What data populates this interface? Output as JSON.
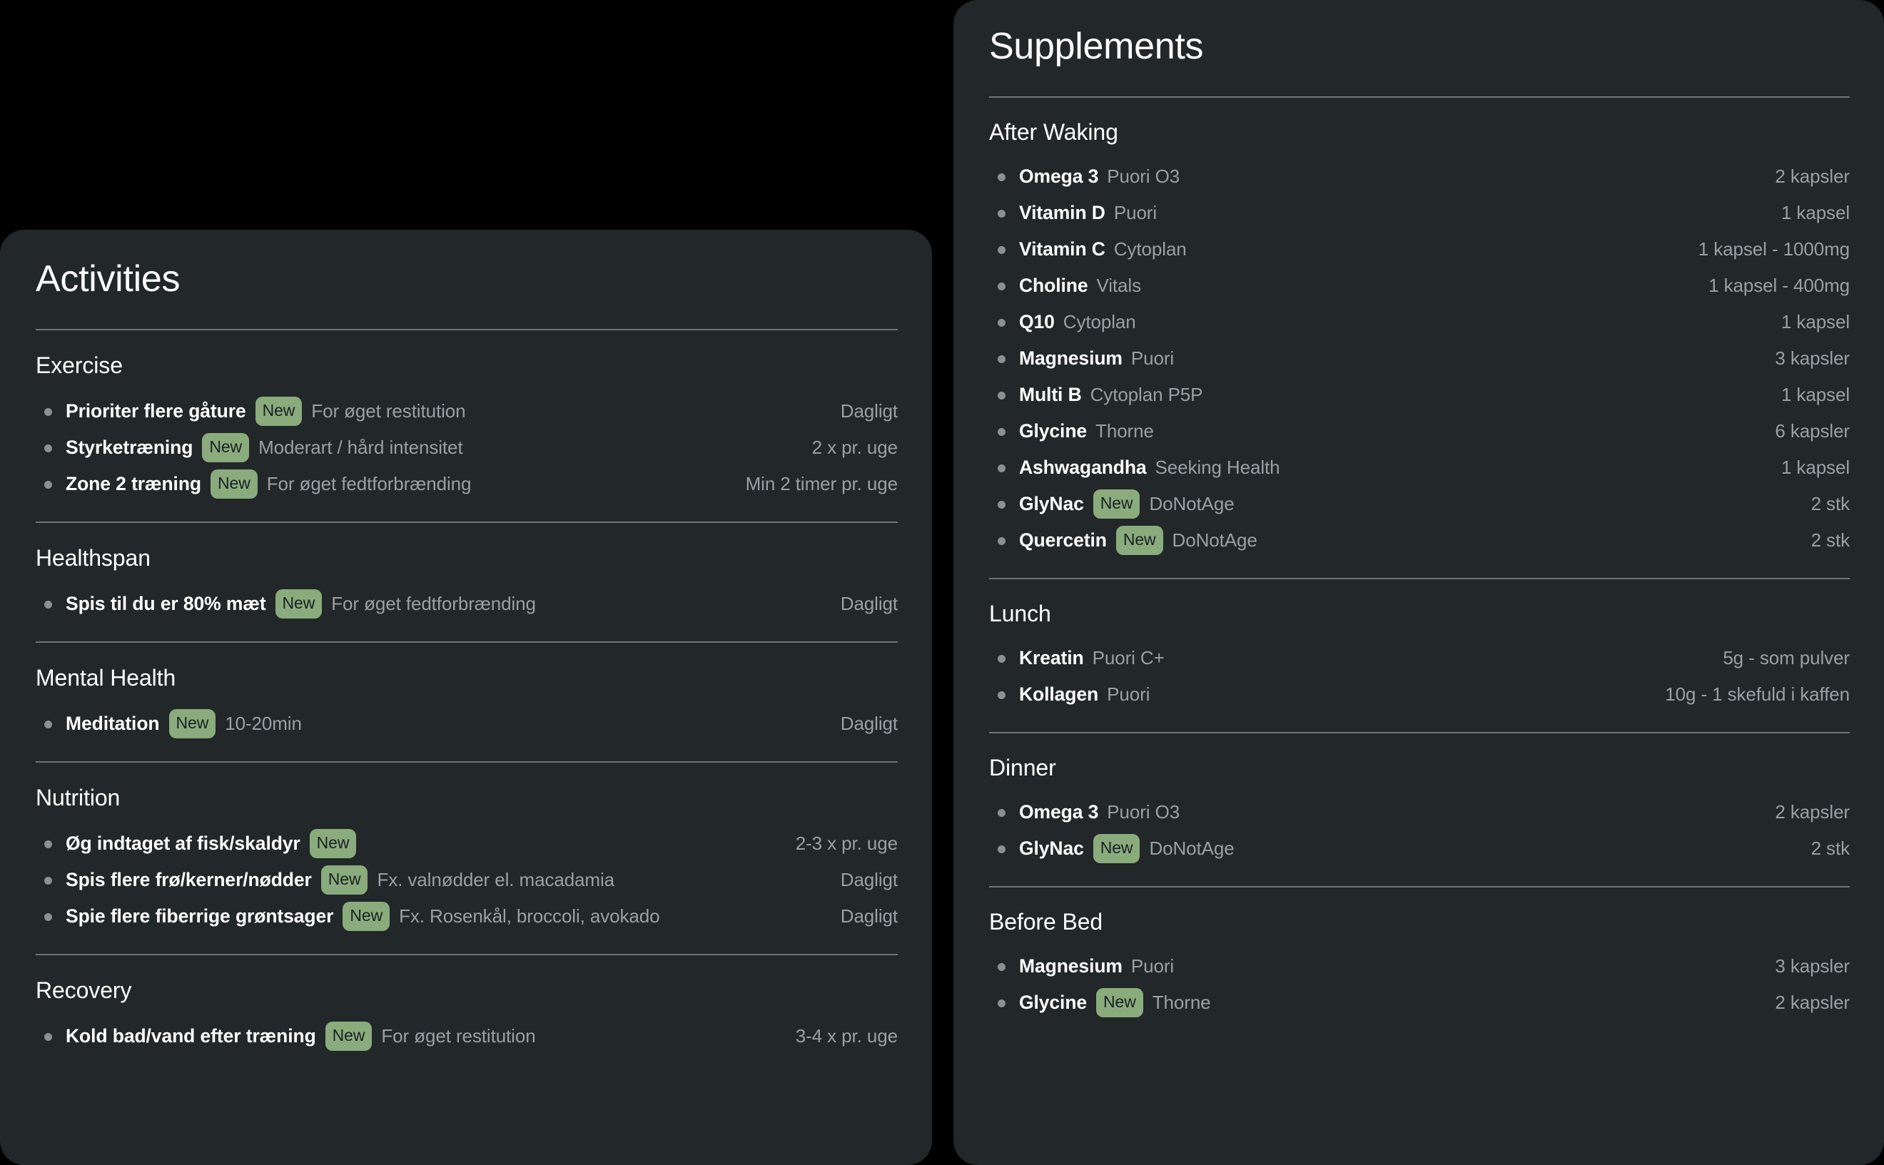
{
  "theme": {
    "page_background": "#000000",
    "panel_background": "#222729",
    "rule_color": "#6d7477",
    "badge_background": "#8aab7c",
    "badge_text": "#1b2124",
    "primary_text": "#ffffff",
    "muted_text": "#9aa0a3",
    "bullet_color": "#8b9093"
  },
  "badge_label": "New",
  "activities": {
    "title": "Activities",
    "sections": [
      {
        "heading": "Exercise",
        "rows": [
          {
            "name": "Prioriter flere gåture",
            "badge": "New",
            "note": "For øget restitution",
            "value": "Dagligt"
          },
          {
            "name": "Styrketræning",
            "badge": "New",
            "note": "Moderart / hård intensitet",
            "value": "2 x pr. uge"
          },
          {
            "name": "Zone 2 træning",
            "badge": "New",
            "note": "For øget fedtforbrænding",
            "value": "Min 2 timer pr. uge"
          }
        ]
      },
      {
        "heading": "Healthspan",
        "rows": [
          {
            "name": "Spis til du er 80% mæt",
            "badge": "New",
            "note": "For øget fedtforbrænding",
            "value": "Dagligt"
          }
        ]
      },
      {
        "heading": "Mental Health",
        "rows": [
          {
            "name": "Meditation",
            "badge": "New",
            "note": "10-20min",
            "value": "Dagligt"
          }
        ]
      },
      {
        "heading": "Nutrition",
        "rows": [
          {
            "name": "Øg indtaget af fisk/skaldyr",
            "badge": "New",
            "note": "",
            "value": "2-3 x pr. uge"
          },
          {
            "name": "Spis flere frø/kerner/nødder",
            "badge": "New",
            "note": "Fx. valnødder el. macadamia",
            "value": "Dagligt"
          },
          {
            "name": "Spie flere fiberrige grøntsager",
            "badge": "New",
            "note": "Fx. Rosenkål, broccoli, avokado",
            "value": "Dagligt"
          }
        ]
      },
      {
        "heading": "Recovery",
        "rows": [
          {
            "name": "Kold bad/vand efter træning",
            "badge": "New",
            "note": "For øget restitution",
            "value": "3-4 x pr. uge"
          }
        ]
      }
    ]
  },
  "supplements": {
    "title": "Supplements",
    "sections": [
      {
        "heading": "After Waking",
        "rows": [
          {
            "name": "Omega 3",
            "badge": "",
            "note": "Puori O3",
            "value": "2 kapsler"
          },
          {
            "name": "Vitamin D",
            "badge": "",
            "note": "Puori",
            "value": "1 kapsel"
          },
          {
            "name": "Vitamin C",
            "badge": "",
            "note": "Cytoplan",
            "value": "1 kapsel - 1000mg"
          },
          {
            "name": "Choline",
            "badge": "",
            "note": "Vitals",
            "value": "1 kapsel - 400mg"
          },
          {
            "name": "Q10",
            "badge": "",
            "note": "Cytoplan",
            "value": "1 kapsel"
          },
          {
            "name": "Magnesium",
            "badge": "",
            "note": "Puori",
            "value": "3 kapsler"
          },
          {
            "name": "Multi B",
            "badge": "",
            "note": "Cytoplan P5P",
            "value": "1 kapsel"
          },
          {
            "name": "Glycine",
            "badge": "",
            "note": "Thorne",
            "value": "6 kapsler"
          },
          {
            "name": "Ashwagandha",
            "badge": "",
            "note": "Seeking Health",
            "value": "1 kapsel"
          },
          {
            "name": "GlyNac",
            "badge": "New",
            "note": "DoNotAge",
            "value": "2 stk"
          },
          {
            "name": "Quercetin",
            "badge": "New",
            "note": "DoNotAge",
            "value": "2 stk"
          }
        ]
      },
      {
        "heading": "Lunch",
        "rows": [
          {
            "name": "Kreatin",
            "badge": "",
            "note": "Puori C+",
            "value": "5g - som pulver"
          },
          {
            "name": "Kollagen",
            "badge": "",
            "note": "Puori",
            "value": "10g - 1 skefuld i kaffen"
          }
        ]
      },
      {
        "heading": "Dinner",
        "rows": [
          {
            "name": "Omega 3",
            "badge": "",
            "note": "Puori O3",
            "value": "2 kapsler"
          },
          {
            "name": "GlyNac",
            "badge": "New",
            "note": "DoNotAge",
            "value": "2 stk"
          }
        ]
      },
      {
        "heading": "Before Bed",
        "rows": [
          {
            "name": "Magnesium",
            "badge": "",
            "note": "Puori",
            "value": "3 kapsler"
          },
          {
            "name": "Glycine",
            "badge": "New",
            "note": "Thorne",
            "value": "2 kapsler"
          }
        ]
      }
    ]
  }
}
